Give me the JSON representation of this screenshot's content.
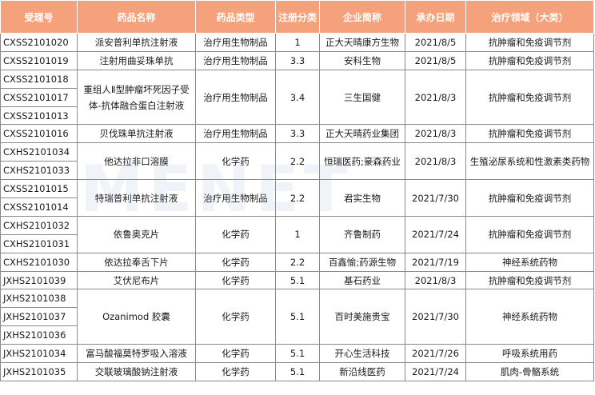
{
  "headers": [
    "受理号",
    "药品名称",
    "药品类型",
    "注册分类",
    "企业简称",
    "承办日期",
    "治疗领域（大类）"
  ],
  "ids": [
    "CXSS2101020",
    "CXSS2101019",
    "CXSS2101018",
    "CXSS2101017",
    "CXSS2101013",
    "CXSS2101016",
    "CXHS2101034",
    "CXHS2101033",
    "CXSS2101015",
    "CXSS2101014",
    "CXHS2101032",
    "CXHS2101031",
    "CXHS2101030",
    "JXHS2101039",
    "JXHS2101038",
    "JXHS2101037",
    "JXHS2101036",
    "JXHS2101034",
    "JXHS2101035"
  ],
  "groups": [
    {
      "name": "派安普利单抗注射液",
      "type": "治疗用生物制品",
      "cls": "1",
      "company": "正大天晴康方生物",
      "date": "2021/8/5",
      "area": "抗肿瘤和免疫调节剂"
    },
    {
      "name": "注射用曲妥珠单抗",
      "type": "治疗用生物制品",
      "cls": "3.3",
      "company": "安科生物",
      "date": "2021/8/5",
      "area": "抗肿瘤和免疫调节剂"
    },
    {
      "name": "重组人Ⅱ型肿瘤坏死因子受体-抗体融合蛋白注射液",
      "type": "治疗用生物制品",
      "cls": "3.4",
      "company": "三生国健",
      "date": "2021/8/3",
      "area": "抗肿瘤和免疫调节剂"
    },
    {
      "name": "贝伐珠单抗注射液",
      "type": "治疗用生物制品",
      "cls": "3.3",
      "company": "正大天晴药业集团",
      "date": "2021/8/3",
      "area": "抗肿瘤和免疫调节剂"
    },
    {
      "name": "他达拉非口溶膜",
      "type": "化学药",
      "cls": "2.2",
      "company": "恒瑞医药;豪森药业",
      "date": "2021/8/3",
      "area": "生殖泌尿系统和性激素类药物"
    },
    {
      "name": "特瑞普利单抗注射液",
      "type": "治疗用生物制品",
      "cls": "2.2",
      "company": "君实生物",
      "date": "2021/7/30",
      "area": "抗肿瘤和免疫调节剂"
    },
    {
      "name": "依鲁奥克片",
      "type": "化学药",
      "cls": "1",
      "company": "齐鲁制药",
      "date": "2021/7/24",
      "area": "抗肿瘤和免疫调节剂"
    },
    {
      "name": "依达拉奉舌下片",
      "type": "化学药",
      "cls": "2.2",
      "company": "百鑫愉;药源生物",
      "date": "2021/7/19",
      "area": "神经系统药物"
    },
    {
      "name": "艾伏尼布片",
      "type": "化学药",
      "cls": "5.1",
      "company": "基石药业",
      "date": "2021/8/3",
      "area": "抗肿瘤和免疫调节剂"
    },
    {
      "name": "Ozanimod 胶囊",
      "type": "化学药",
      "cls": "5.1",
      "company": "百时美施贵宝",
      "date": "2021/7/30",
      "area": "神经系统药物"
    },
    {
      "name": "富马酸福莫特罗吸入溶液",
      "type": "化学药",
      "cls": "5.1",
      "company": "开心生活科技",
      "date": "2021/7/26",
      "area": "呼吸系统用药"
    },
    {
      "name": "交联玻璃酸钠注射液",
      "type": "化学药",
      "cls": "5.1",
      "company": "新沿线医药",
      "date": "2021/7/24",
      "area": "肌肉-骨骼系统"
    }
  ],
  "watermark": "MENET"
}
